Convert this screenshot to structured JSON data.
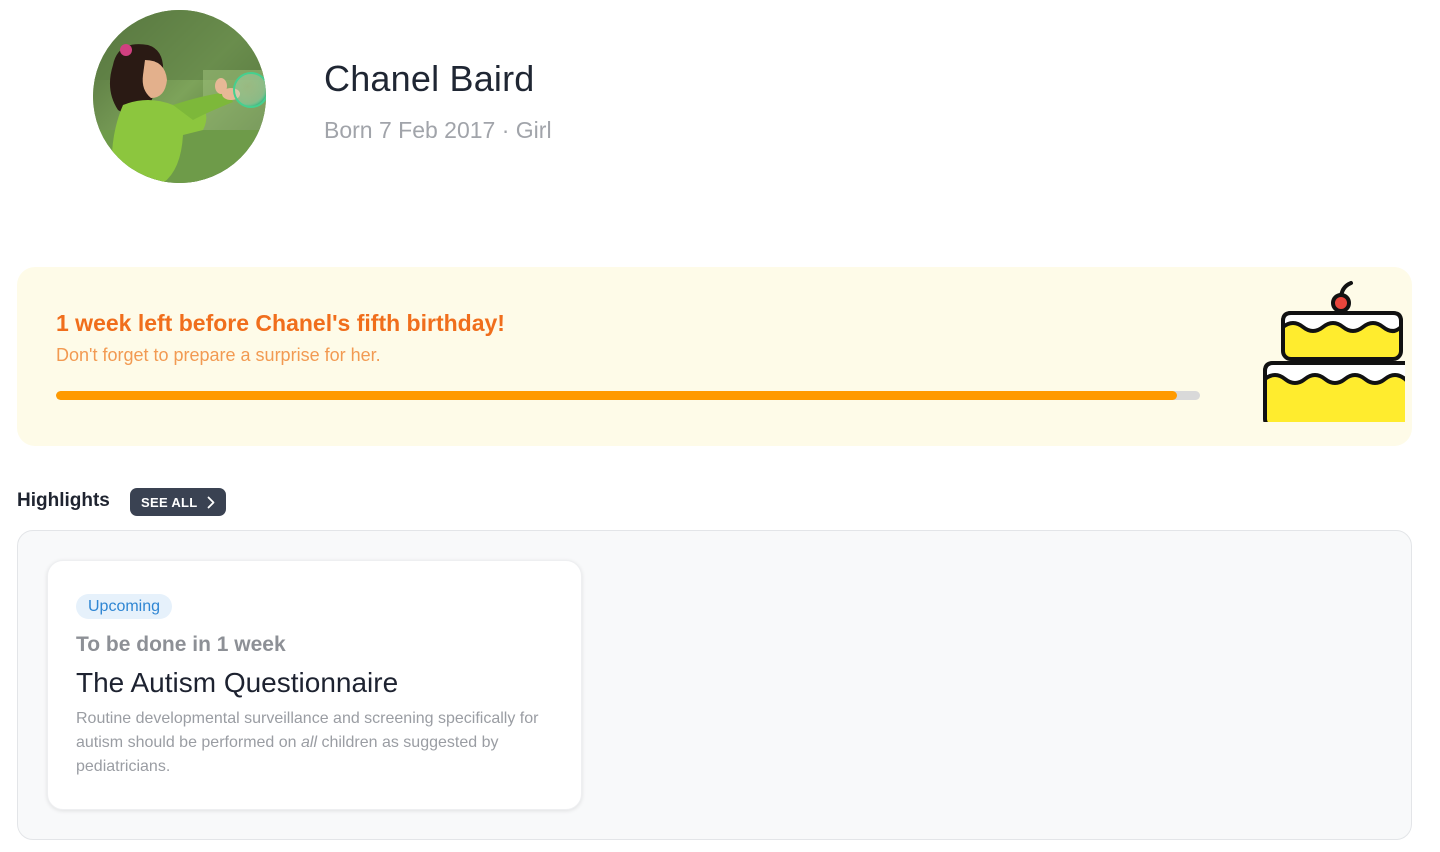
{
  "profile": {
    "name": "Chanel Baird",
    "meta": "Born 7 Feb 2017 · Girl",
    "avatar_icon": "child-photo-avatar"
  },
  "birthday_banner": {
    "title": "1 week left before Chanel's fifth birthday!",
    "subtitle": "Don't forget to prepare a surprise for her.",
    "progress_percent": 98,
    "icon": "birthday-cake-icon",
    "colors": {
      "background": "#fefbe8",
      "title": "#f06e1c",
      "progress": "#ff9a00"
    }
  },
  "highlights": {
    "title": "Highlights",
    "see_all_label": "SEE ALL",
    "see_all_icon": "chevron-right-icon",
    "cards": [
      {
        "badge": "Upcoming",
        "due": "To be done in 1 week",
        "title": "The Autism Questionnaire",
        "description_before": "Routine developmental surveillance and screening specifically for autism should be performed on ",
        "description_emphasis": "all",
        "description_after": " children as suggested by pediatricians."
      }
    ]
  }
}
